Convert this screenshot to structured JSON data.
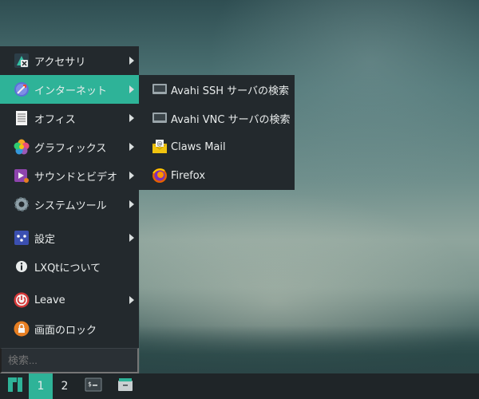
{
  "menu": {
    "items": [
      {
        "label": "アクセサリ",
        "icon": "accessories-icon",
        "submenu": true
      },
      {
        "label": "インターネット",
        "icon": "internet-icon",
        "submenu": true,
        "highlighted": true
      },
      {
        "label": "オフィス",
        "icon": "office-icon",
        "submenu": true
      },
      {
        "label": "グラフィックス",
        "icon": "graphics-icon",
        "submenu": true
      },
      {
        "label": "サウンドとビデオ",
        "icon": "sound-video-icon",
        "submenu": true
      },
      {
        "label": "システムツール",
        "icon": "system-tools-icon",
        "submenu": true
      },
      {
        "label": "設定",
        "icon": "settings-icon",
        "submenu": true
      },
      {
        "label": "LXQtについて",
        "icon": "info-icon",
        "submenu": false
      },
      {
        "label": "Leave",
        "icon": "power-icon",
        "submenu": true
      },
      {
        "label": "画面のロック",
        "icon": "lock-icon",
        "submenu": false
      }
    ],
    "search_placeholder": "検索..."
  },
  "submenu": {
    "items": [
      {
        "label": "Avahi SSH サーバの検索",
        "icon": "network-server-icon"
      },
      {
        "label": "Avahi VNC サーバの検索",
        "icon": "network-server-icon"
      },
      {
        "label": "Claws Mail",
        "icon": "mail-icon"
      },
      {
        "label": "Firefox",
        "icon": "firefox-icon"
      }
    ]
  },
  "taskbar": {
    "desktops": [
      "1",
      "2"
    ],
    "active_desktop": "1"
  },
  "colors": {
    "accent": "#2eb398",
    "menu_bg": "#23292d",
    "taskbar_bg": "#1f2528"
  }
}
